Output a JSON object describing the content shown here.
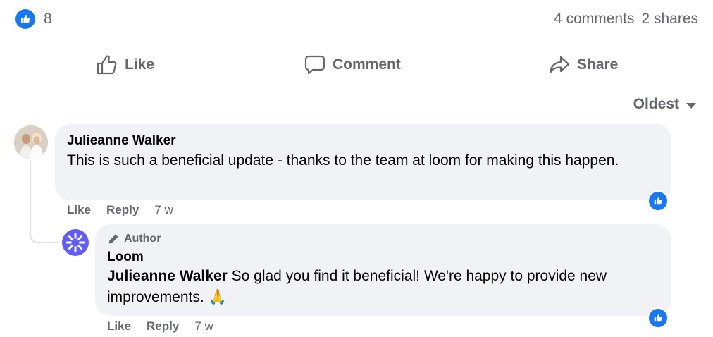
{
  "stats": {
    "reaction_count": "8",
    "comments": "4 comments",
    "shares": "2 shares"
  },
  "actions": {
    "like": "Like",
    "comment": "Comment",
    "share": "Share"
  },
  "sort": {
    "label": "Oldest"
  },
  "comments": [
    {
      "author": "Julieanne Walker",
      "text": "This is such a beneficial update - thanks to the team at loom for making this happen.",
      "like": "Like",
      "reply": "Reply",
      "time": "7 w"
    }
  ],
  "reply": {
    "badge": "Author",
    "author": "Loom",
    "mention": "Julieanne Walker",
    "text": "So glad you find it beneficial! We're happy to provide new improvements.",
    "emoji": "🙏",
    "like": "Like",
    "reply": "Reply",
    "time": "7 w"
  },
  "colors": {
    "brand_blue": "#1877f2",
    "secondary_text": "#65676b",
    "bubble_bg": "#f0f2f5",
    "loom_purple": "#625df5"
  },
  "icons": [
    "like-reaction-icon",
    "thumbs-up-icon",
    "comment-icon",
    "share-icon",
    "caret-down-icon",
    "pencil-icon",
    "loom-logo-icon"
  ]
}
